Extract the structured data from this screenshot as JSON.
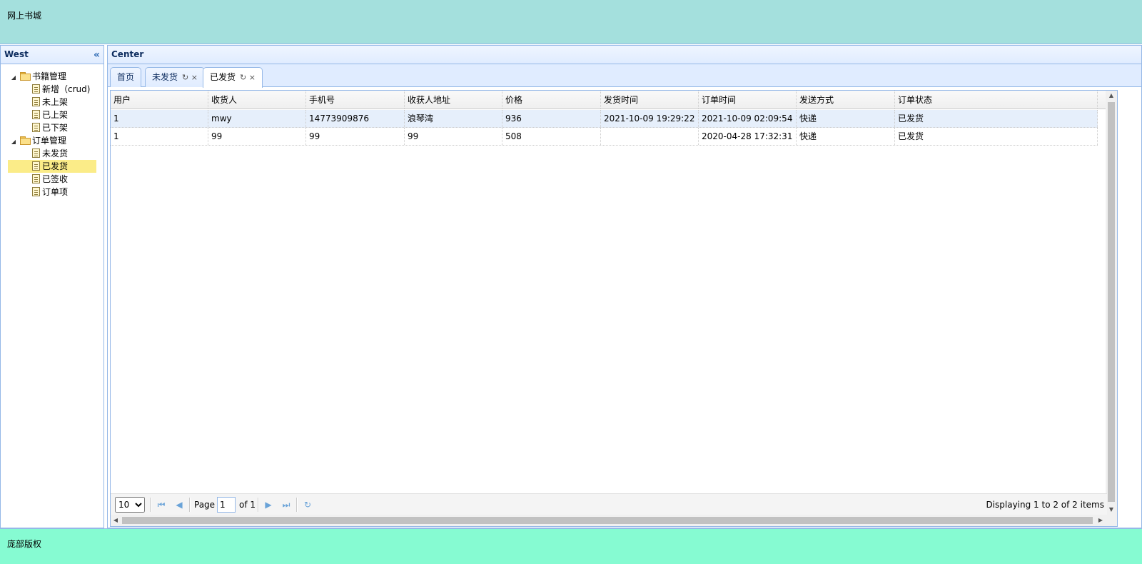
{
  "north": {
    "title": "网上书城"
  },
  "south": {
    "copyright": "庞部版权"
  },
  "west": {
    "title": "West",
    "tree": [
      {
        "label": "书籍管理",
        "children": [
          "新增（crud)",
          "未上架",
          "已上架",
          "已下架"
        ]
      },
      {
        "label": "订单管理",
        "children": [
          "未发货",
          "已发货",
          "已签收",
          "订单项"
        ]
      }
    ],
    "selected": "已发货"
  },
  "center": {
    "title": "Center",
    "tabs": [
      {
        "label": "首页"
      },
      {
        "label": "未发货"
      },
      {
        "label": "已发货"
      }
    ],
    "active_tab": "已发货"
  },
  "grid": {
    "columns": [
      "用户",
      "收货人",
      "手机号",
      "收获人地址",
      "价格",
      "发货时间",
      "订单时间",
      "发送方式",
      "订单状态"
    ],
    "rows": [
      [
        "1",
        "mwy",
        "14773909876",
        "浪琴湾",
        "936",
        "2021-10-09 19:29:22",
        "2021-10-09 02:09:54",
        "快递",
        "已发货"
      ],
      [
        "1",
        "99",
        "99",
        "99",
        "508",
        "",
        "2020-04-28 17:32:31",
        "快递",
        "已发货"
      ]
    ]
  },
  "pager": {
    "page_size": "10",
    "page_label": "Page",
    "page_value": "1",
    "of_label": "of 1",
    "info": "Displaying 1 to 2 of 2 items"
  },
  "icons": {
    "collapse": "double-chevron-left-icon",
    "refresh": "refresh-icon",
    "close": "close-icon"
  }
}
